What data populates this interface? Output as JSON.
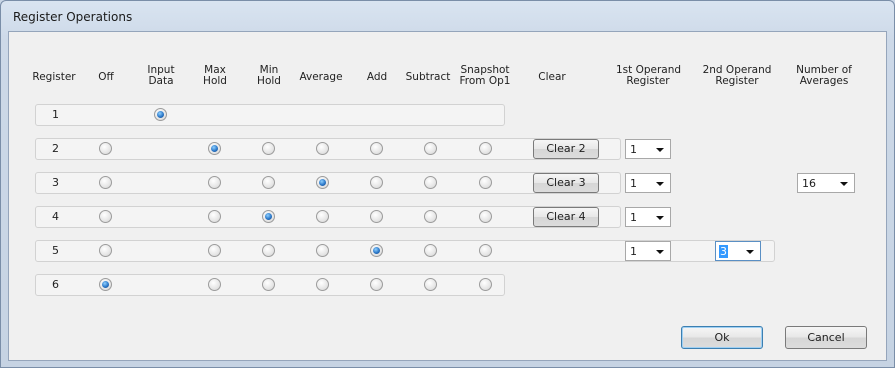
{
  "window": {
    "title": "Register Operations"
  },
  "headers": {
    "register": "Register",
    "off": "Off",
    "input_data": [
      "Input",
      "Data"
    ],
    "max_hold": [
      "Max",
      "Hold"
    ],
    "min_hold": [
      "Min",
      "Hold"
    ],
    "average": "Average",
    "add": "Add",
    "subtract": "Subtract",
    "snapshot": [
      "Snapshot",
      "From Op1"
    ],
    "clear": "Clear",
    "operand1": [
      "1st Operand",
      "Register"
    ],
    "operand2": [
      "2nd Operand",
      "Register"
    ],
    "num_averages": [
      "Number of",
      "Averages"
    ]
  },
  "rows": [
    {
      "register": "1",
      "selected": "input_data"
    },
    {
      "register": "2",
      "selected": "max_hold",
      "clear_label": "Clear 2",
      "operand1": "1"
    },
    {
      "register": "3",
      "selected": "average",
      "clear_label": "Clear 3",
      "operand1": "1",
      "num_averages": "16"
    },
    {
      "register": "4",
      "selected": "min_hold",
      "clear_label": "Clear 4",
      "operand1": "1"
    },
    {
      "register": "5",
      "selected": "add",
      "operand1": "1",
      "operand2": "3"
    },
    {
      "register": "6",
      "selected": "off"
    }
  ],
  "buttons": {
    "ok": "Ok",
    "cancel": "Cancel"
  }
}
